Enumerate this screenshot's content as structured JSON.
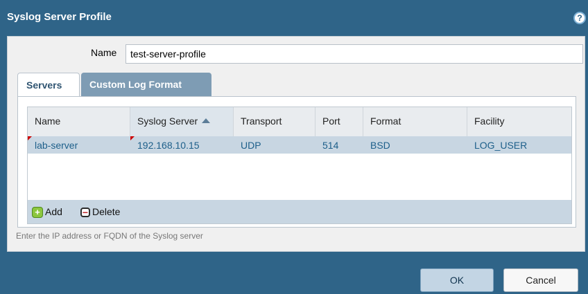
{
  "dialog": {
    "title": "Syslog Server Profile",
    "help_icon": "help-icon",
    "name_label": "Name",
    "name_value": "test-server-profile"
  },
  "tabs": [
    {
      "label": "Servers",
      "active": true
    },
    {
      "label": "Custom Log Format",
      "active": false
    }
  ],
  "table": {
    "columns": [
      "Name",
      "Syslog Server",
      "Transport",
      "Port",
      "Format",
      "Facility"
    ],
    "sorted_column": "Syslog Server",
    "sort_direction": "ascending",
    "rows": [
      {
        "name": "lab-server",
        "server": "192.168.10.15",
        "transport": "UDP",
        "port": "514",
        "format": "BSD",
        "facility": "LOG_USER"
      }
    ]
  },
  "toolbar": {
    "add_label": "Add",
    "delete_label": "Delete"
  },
  "hint": "Enter the IP address or FQDN of the Syslog server",
  "buttons": {
    "ok_label": "OK",
    "cancel_label": "Cancel"
  },
  "colors": {
    "titlebar": "#2f6488",
    "row_selected": "#c8d6e2",
    "row_text": "#1d5f8a",
    "inactive_tab": "#7e9cb4"
  }
}
